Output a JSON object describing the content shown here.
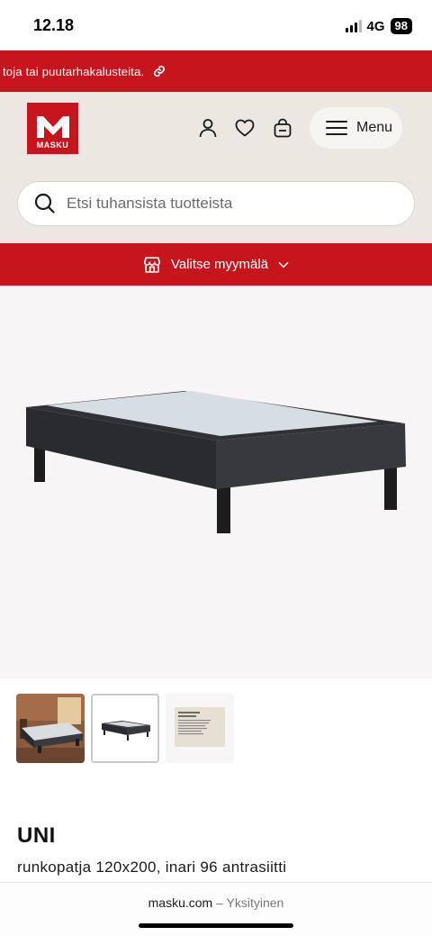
{
  "status_bar": {
    "time": "12.18",
    "network": "4G",
    "battery": "98"
  },
  "promo": {
    "text": "toja tai puutarhakalusteita."
  },
  "header": {
    "logo_text": "MASKU",
    "menu_label": "Menu",
    "search_placeholder": "Etsi tuhansista tuotteista"
  },
  "store_selector": {
    "label": "Valitse myymälä"
  },
  "product": {
    "title": "UNI",
    "subtitle": "runkopatja 120x200, inari 96 antrasiitti"
  },
  "browser": {
    "domain": "masku.com",
    "separator": " – ",
    "mode": "Yksityinen"
  },
  "colors": {
    "brand_red": "#c4161c",
    "header_bg": "#ebe7e1"
  },
  "icons": [
    "link-icon",
    "user-icon",
    "heart-icon",
    "bag-icon",
    "hamburger-icon",
    "search-icon",
    "store-icon",
    "chevron-down-icon"
  ]
}
